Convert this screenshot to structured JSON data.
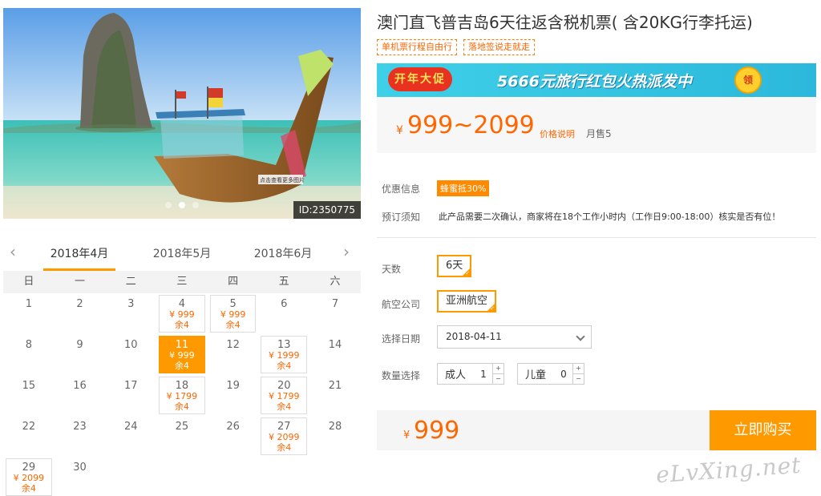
{
  "product": {
    "title": "澳门直飞普吉岛6天往返含税机票( 含20KG行李托运)",
    "tags": [
      "单机票行程自由行",
      "落地签说走就走"
    ],
    "image_id": "ID:2350775",
    "sign_text": "点击查看更多图片"
  },
  "banner": {
    "badge": "开年大促",
    "text": "5666元旅行红包火热派发中",
    "coin": "领"
  },
  "price": {
    "currency": "¥",
    "range": "999~2099",
    "note": "价格说明",
    "monthly_sales": "月售5"
  },
  "info": {
    "promo_label": "优惠信息",
    "promo_tag": "蜂蜜抵30%",
    "notice_label": "预订须知",
    "notice_text": "此产品需要二次确认，商家将在18个工作小时内（工作日9:00-18:00）核实是否有位！"
  },
  "options": {
    "days_label": "天数",
    "days_value": "6天",
    "airline_label": "航空公司",
    "airline_value": "亚洲航空",
    "date_label": "选择日期",
    "date_value": "2018-04-11",
    "qty_label": "数量选择",
    "adult_label": "成人",
    "adult_value": "1",
    "child_label": "儿童",
    "child_value": "0",
    "plus": "+",
    "minus": "−"
  },
  "buy": {
    "currency": "¥",
    "price": "999",
    "button": "立即购买"
  },
  "calendar": {
    "prev": "‹",
    "next": "›",
    "months": [
      "2018年4月",
      "2018年5月",
      "2018年6月"
    ],
    "weekdays": [
      "日",
      "一",
      "二",
      "三",
      "四",
      "五",
      "六"
    ],
    "days": [
      {
        "day": "1"
      },
      {
        "day": "2"
      },
      {
        "day": "3"
      },
      {
        "day": "4",
        "price": "¥ 999",
        "left": "余4"
      },
      {
        "day": "5",
        "price": "¥ 999",
        "left": "余4"
      },
      {
        "day": "6"
      },
      {
        "day": "7"
      },
      {
        "day": "8"
      },
      {
        "day": "9"
      },
      {
        "day": "10"
      },
      {
        "day": "11",
        "price": "¥ 999",
        "left": "余4",
        "selected": true
      },
      {
        "day": "12"
      },
      {
        "day": "13",
        "price": "¥ 1999",
        "left": "余4"
      },
      {
        "day": "14"
      },
      {
        "day": "15"
      },
      {
        "day": "16"
      },
      {
        "day": "17"
      },
      {
        "day": "18",
        "price": "¥ 1799",
        "left": "余4"
      },
      {
        "day": "19"
      },
      {
        "day": "20",
        "price": "¥ 1799",
        "left": "余4"
      },
      {
        "day": "21"
      },
      {
        "day": "22"
      },
      {
        "day": "23"
      },
      {
        "day": "24"
      },
      {
        "day": "25"
      },
      {
        "day": "26"
      },
      {
        "day": "27",
        "price": "¥ 2099",
        "left": "余4"
      },
      {
        "day": "28"
      },
      {
        "day": "29",
        "price": "¥ 2099",
        "left": "余4"
      },
      {
        "day": "30"
      }
    ]
  },
  "watermark": "eLvXing.net"
}
